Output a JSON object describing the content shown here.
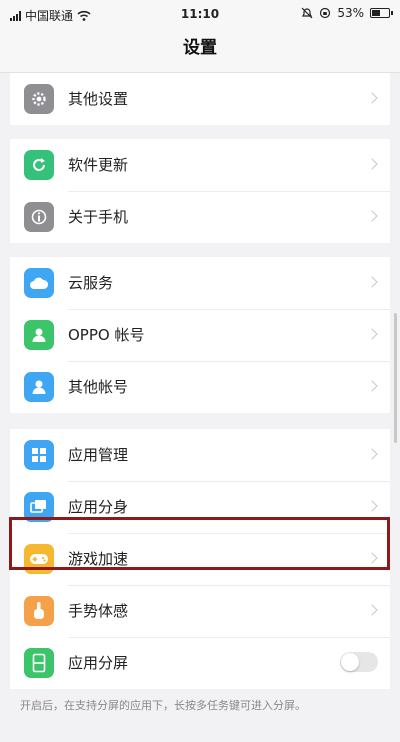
{
  "status_bar": {
    "carrier": "中国联通",
    "time": "11:10",
    "battery": "53%",
    "battery_level": 0.53
  },
  "header": {
    "title": "设置"
  },
  "groups": [
    {
      "items": [
        {
          "label": "其他设置",
          "icon": "gear-icon",
          "icon_color": "#8e8e93"
        }
      ]
    },
    {
      "items": [
        {
          "label": "软件更新",
          "icon": "update-icon",
          "icon_color": "#34c27a"
        },
        {
          "label": "关于手机",
          "icon": "info-icon",
          "icon_color": "#8e8e93"
        }
      ]
    },
    {
      "items": [
        {
          "label": "云服务",
          "icon": "cloud-icon",
          "icon_color": "#3ea6f2"
        },
        {
          "label": "OPPO 帐号",
          "icon": "account-icon",
          "icon_color": "#3cc46a"
        },
        {
          "label": "其他帐号",
          "icon": "other-account-icon",
          "icon_color": "#3ea6f2"
        }
      ]
    },
    {
      "items": [
        {
          "label": "应用管理",
          "icon": "app-manage-icon",
          "icon_color": "#3ea6f2"
        },
        {
          "label": "应用分身",
          "icon": "app-clone-icon",
          "icon_color": "#3ea6f2"
        },
        {
          "label": "游戏加速",
          "icon": "game-icon",
          "icon_color": "#f5b82e"
        },
        {
          "label": "手势体感",
          "icon": "gesture-icon",
          "icon_color": "#f5a14a"
        },
        {
          "label": "应用分屏",
          "icon": "split-screen-icon",
          "icon_color": "#3cc46a",
          "toggle": false
        }
      ]
    }
  ],
  "footnote": "开启后，在支持分屏的应用下，长按多任务键可进入分屏。"
}
